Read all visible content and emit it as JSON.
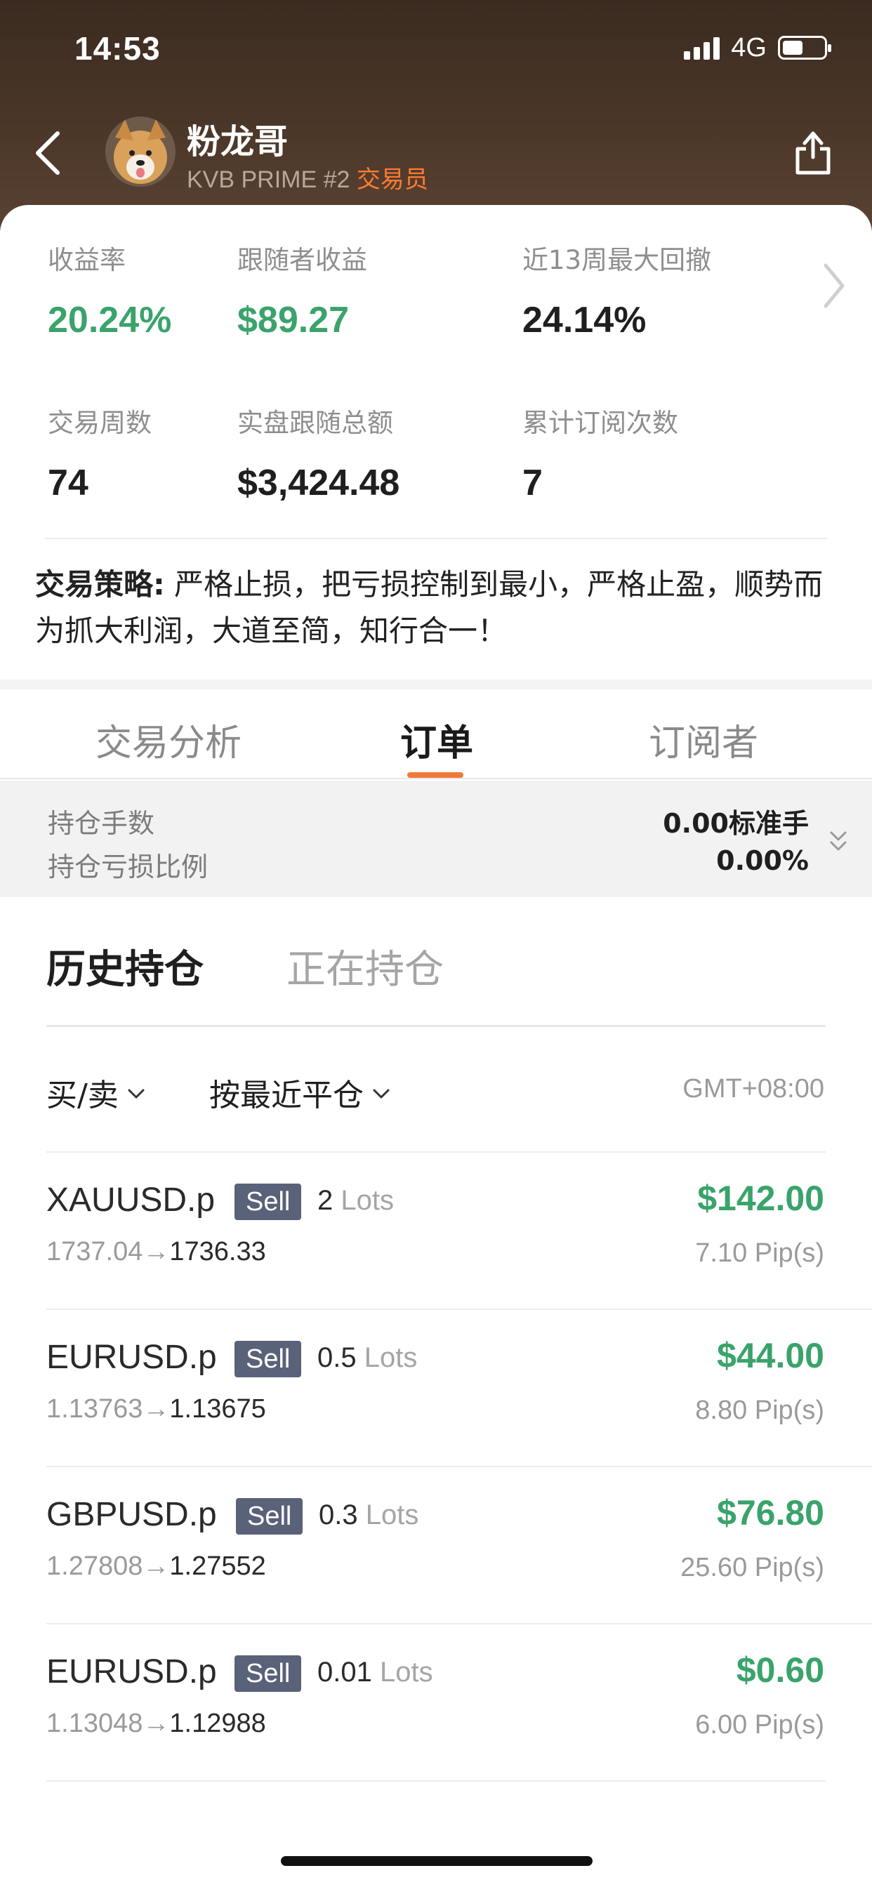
{
  "status_bar": {
    "time": "14:53",
    "network": "4G"
  },
  "header": {
    "name": "粉龙哥",
    "account": "KVB PRIME #2",
    "role": "交易员"
  },
  "stats": [
    {
      "label": "收益率",
      "value": "20.24%"
    },
    {
      "label": "跟随者收益",
      "value": "$89.27"
    },
    {
      "label": "近13周最大回撤",
      "value": "24.14%"
    },
    {
      "label": "交易周数",
      "value": "74"
    },
    {
      "label": "实盘跟随总额",
      "value": "$3,424.48"
    },
    {
      "label": "累计订阅次数",
      "value": "7"
    }
  ],
  "strategy": {
    "label": "交易策略:",
    "text": " 严格止损，把亏损控制到最小，严格止盈，顺势而为抓大利润，大道至简，知行合一！"
  },
  "tabs": [
    {
      "label": "交易分析"
    },
    {
      "label": "订单"
    },
    {
      "label": "订阅者"
    }
  ],
  "summary": {
    "position_lots_label": "持仓手数",
    "position_lots_value": "0.00标准手",
    "position_loss_label": "持仓亏损比例",
    "position_loss_value": "0.00%"
  },
  "sub_tabs": [
    {
      "label": "历史持仓"
    },
    {
      "label": "正在持仓"
    }
  ],
  "filters": {
    "side": "买/卖",
    "sort": "按最近平仓",
    "timezone": "GMT+08:00"
  },
  "orders": [
    {
      "symbol": "XAUUSD.p",
      "side": "Sell",
      "lots": "2",
      "lots_unit": "Lots",
      "open": "1737.04→",
      "close": "1736.33",
      "profit": "$142.00",
      "pips": "7.10 Pip(s)"
    },
    {
      "symbol": "EURUSD.p",
      "side": "Sell",
      "lots": "0.5",
      "lots_unit": "Lots",
      "open": "1.13763→",
      "close": "1.13675",
      "profit": "$44.00",
      "pips": "8.80 Pip(s)"
    },
    {
      "symbol": "GBPUSD.p",
      "side": "Sell",
      "lots": "0.3",
      "lots_unit": "Lots",
      "open": "1.27808→",
      "close": "1.27552",
      "profit": "$76.80",
      "pips": "25.60 Pip(s)"
    },
    {
      "symbol": "EURUSD.p",
      "side": "Sell",
      "lots": "0.01",
      "lots_unit": "Lots",
      "open": "1.13048→",
      "close": "1.12988",
      "profit": "$0.60",
      "pips": "6.00 Pip(s)"
    }
  ],
  "colors": {
    "accent": "#f07a3a",
    "profit_green": "#3aa36b",
    "badge": "#5a6279"
  }
}
